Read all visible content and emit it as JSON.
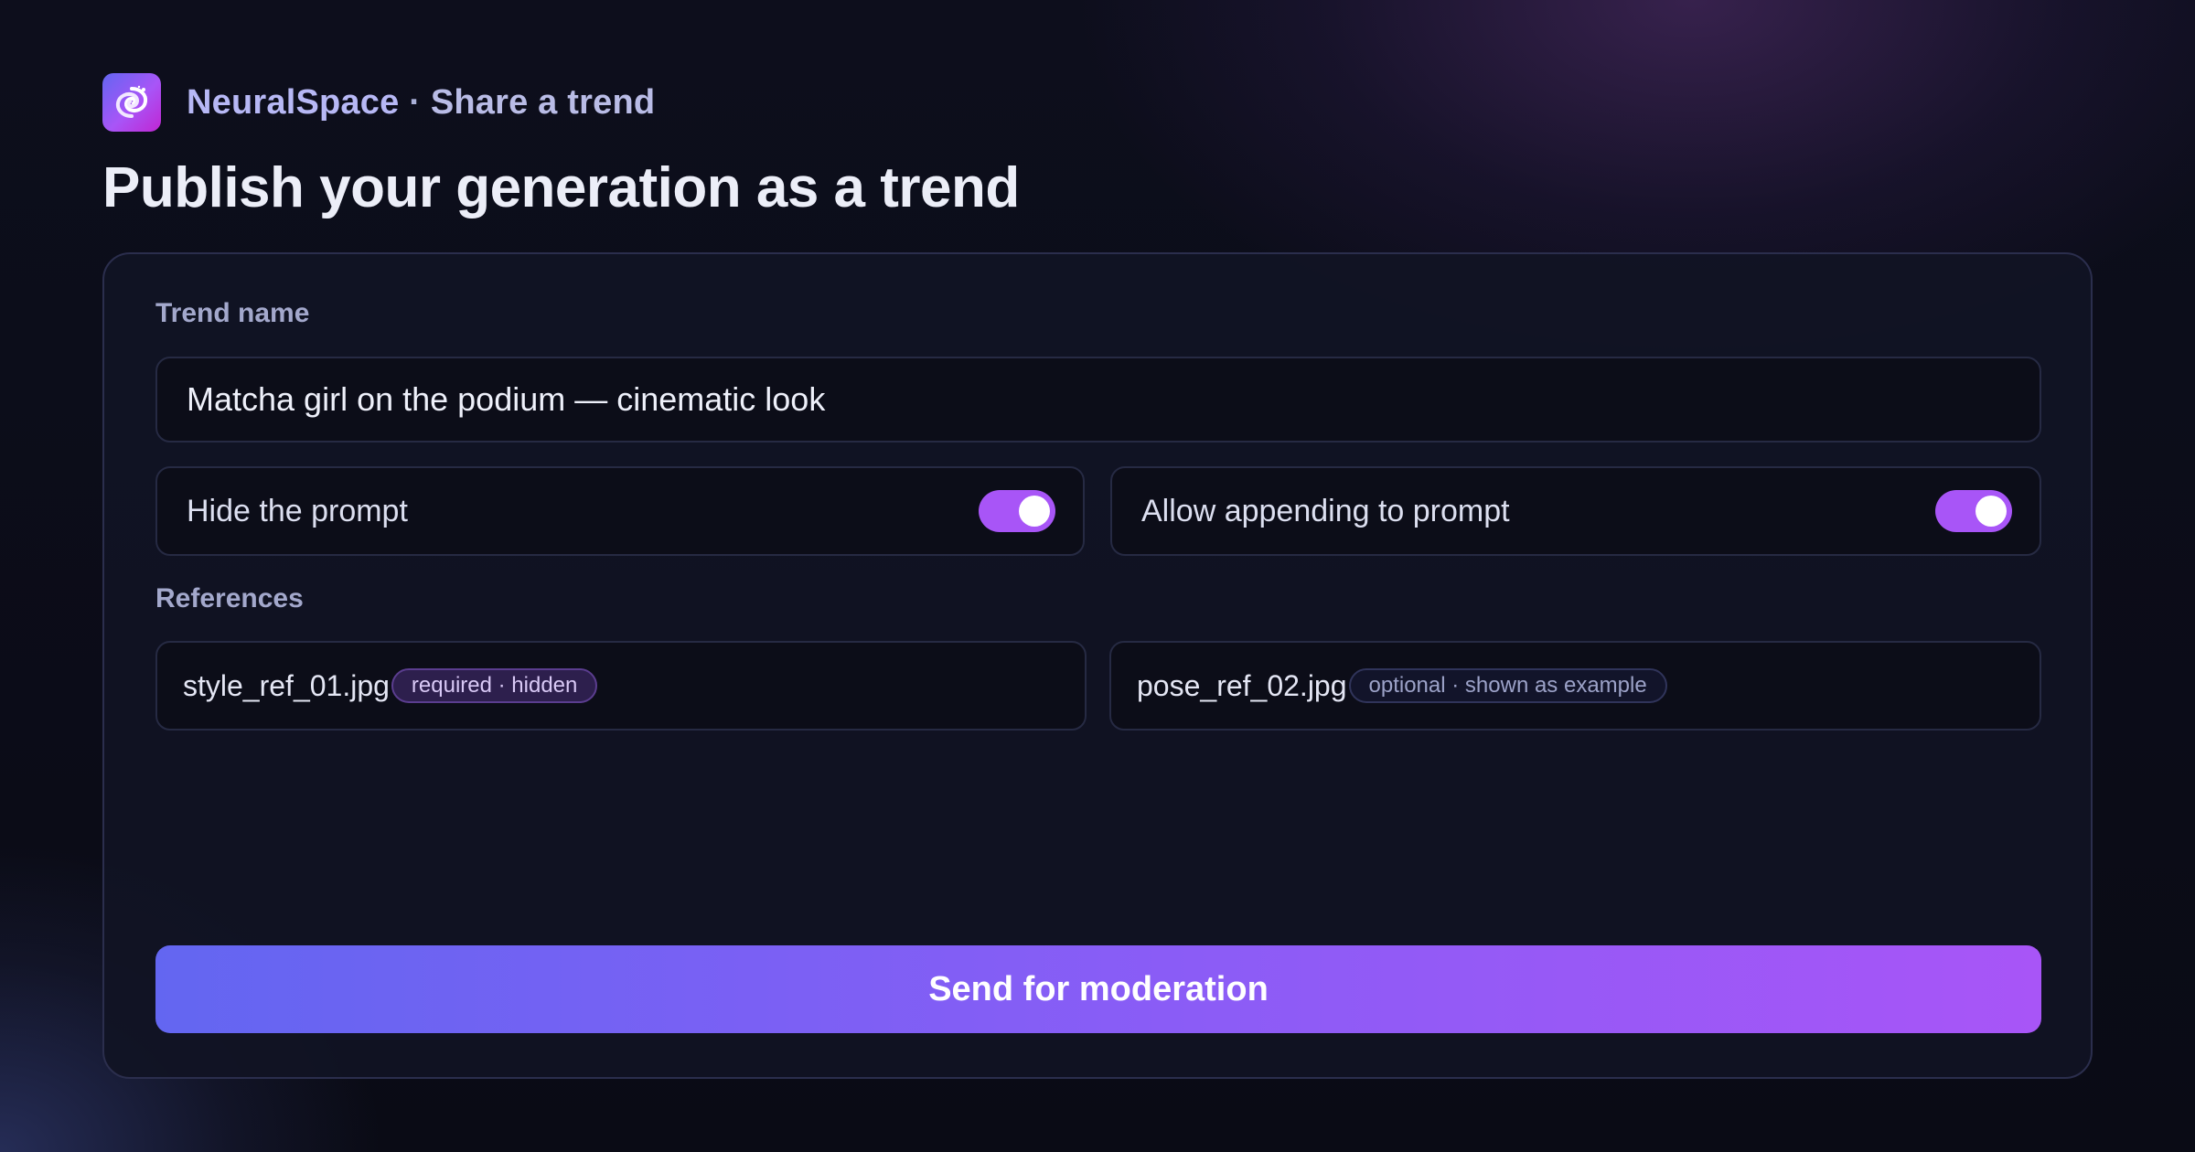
{
  "header": {
    "brand_name": "NeuralSpace",
    "separator": " · ",
    "section": "Share a trend",
    "logo_icon": "galaxy-swirl-icon"
  },
  "page_title": "Publish your generation as a trend",
  "form": {
    "trend_name_label": "Trend name",
    "trend_name_value": "Matcha girl on the podium — cinematic look",
    "toggles": [
      {
        "label": "Hide the prompt",
        "enabled": true
      },
      {
        "label": "Allow appending to prompt",
        "enabled": true
      }
    ],
    "references_label": "References",
    "references": [
      {
        "filename": "style_ref_01.jpg",
        "badge": "required · hidden"
      },
      {
        "filename": "pose_ref_02.jpg",
        "badge": "optional · shown as example"
      }
    ],
    "submit_label": "Send for moderation"
  },
  "colors": {
    "accent_start": "#6366f1",
    "accent_end": "#a855f7",
    "background": "#0b0c17"
  }
}
